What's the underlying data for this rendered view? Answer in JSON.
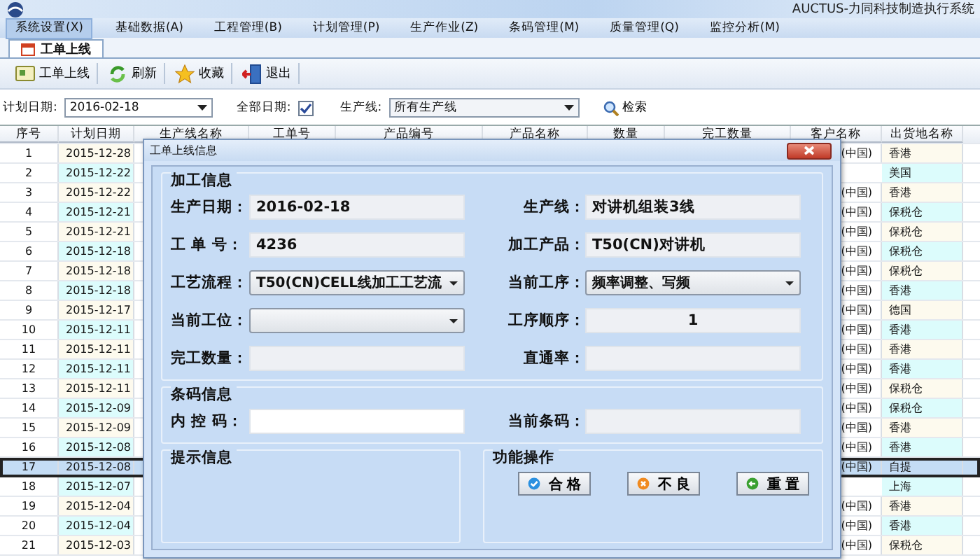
{
  "window": {
    "title": "AUCTUS-力同科技制造执行系统"
  },
  "menu": [
    {
      "label": "系统设置(X)",
      "selected": true
    },
    {
      "label": "基础数据(A)",
      "selected": false
    },
    {
      "label": "工程管理(B)",
      "selected": false
    },
    {
      "label": "计划管理(P)",
      "selected": false
    },
    {
      "label": "生产作业(Z)",
      "selected": false
    },
    {
      "label": "条码管理(M)",
      "selected": false
    },
    {
      "label": "质量管理(Q)",
      "selected": false
    },
    {
      "label": "监控分析(M)",
      "selected": false
    }
  ],
  "tabs": [
    {
      "label": "工单上线",
      "selected": true
    }
  ],
  "toolbar": [
    {
      "label": "工单上线",
      "kind": "online"
    },
    {
      "label": "刷新",
      "kind": "refresh"
    },
    {
      "label": "收藏",
      "kind": "star"
    },
    {
      "label": "退出",
      "kind": "exit"
    }
  ],
  "filter": {
    "plan_date_label": "计划日期:",
    "plan_date": "2016-02-18",
    "all_dates_label": "全部日期:",
    "all_dates_checked": true,
    "line_label": "生产线:",
    "line_value": "所有生产线",
    "search_label": "检索"
  },
  "table": {
    "columns": [
      "序号",
      "计划日期",
      "生产线名称",
      "工单号",
      "产品编号",
      "产品名称",
      "数量",
      "完工数量",
      "客户名称",
      "出货地名称"
    ],
    "rows": [
      {
        "no": "1",
        "date": "2015-12-28",
        "customer": "(中国)",
        "destination": "香港",
        "selected": false
      },
      {
        "no": "2",
        "date": "2015-12-22",
        "destination": "美国",
        "selected": false
      },
      {
        "no": "3",
        "date": "2015-12-22",
        "customer": "(中国)",
        "destination": "香港",
        "selected": false
      },
      {
        "no": "4",
        "date": "2015-12-21",
        "customer": "(中国)",
        "destination": "保税仓",
        "selected": false
      },
      {
        "no": "5",
        "date": "2015-12-21",
        "customer": "(中国)",
        "destination": "保税仓",
        "selected": false
      },
      {
        "no": "6",
        "date": "2015-12-18",
        "customer": "(中国)",
        "destination": "保税仓",
        "selected": false
      },
      {
        "no": "7",
        "date": "2015-12-18",
        "customer": "(中国)",
        "destination": "保税仓",
        "selected": false
      },
      {
        "no": "8",
        "date": "2015-12-18",
        "customer": "(中国)",
        "destination": "香港",
        "selected": false
      },
      {
        "no": "9",
        "date": "2015-12-17",
        "customer": "(中国)",
        "destination": "德国",
        "selected": false
      },
      {
        "no": "10",
        "date": "2015-12-11",
        "customer": "(中国)",
        "destination": "香港",
        "selected": false
      },
      {
        "no": "11",
        "date": "2015-12-11",
        "customer": "(中国)",
        "destination": "香港",
        "selected": false
      },
      {
        "no": "12",
        "date": "2015-12-11",
        "customer": "(中国)",
        "destination": "香港",
        "selected": false
      },
      {
        "no": "13",
        "date": "2015-12-11",
        "customer": "(中国)",
        "destination": "保税仓",
        "selected": false
      },
      {
        "no": "14",
        "date": "2015-12-09",
        "customer": "(中国)",
        "destination": "保税仓",
        "selected": false
      },
      {
        "no": "15",
        "date": "2015-12-09",
        "customer": "(中国)",
        "destination": "香港",
        "selected": false
      },
      {
        "no": "16",
        "date": "2015-12-08",
        "customer": "(中国)",
        "destination": "香港",
        "selected": false
      },
      {
        "no": "17",
        "date": "2015-12-08",
        "customer": "(中国)",
        "destination": "自提",
        "selected": true
      },
      {
        "no": "18",
        "date": "2015-12-07",
        "destination": "上海",
        "selected": false
      },
      {
        "no": "19",
        "date": "2015-12-04",
        "customer": "(中国)",
        "destination": "香港",
        "selected": false
      },
      {
        "no": "20",
        "date": "2015-12-04",
        "customer": "(中国)",
        "destination": "香港",
        "selected": false
      },
      {
        "no": "21",
        "date": "2015-12-03",
        "customer": "(中国)",
        "destination": "保税仓",
        "selected": false
      }
    ]
  },
  "dialog": {
    "title": "工单上线信息",
    "groups": [
      {
        "title": "加工信息",
        "fields": [
          {
            "label": "生产日期：",
            "value": "2016-02-18",
            "kind": "text"
          },
          {
            "label": "生产线：",
            "value": "对讲机组装3线",
            "kind": "text"
          },
          {
            "label": "工 单 号：",
            "value": "4236",
            "kind": "text"
          },
          {
            "label": "加工产品：",
            "value": "T50(CN)对讲机",
            "kind": "text"
          },
          {
            "label": "工艺流程：",
            "value": "T50(CN)CELL线加工工艺流",
            "kind": "dropdown"
          },
          {
            "label": "当前工序：",
            "value": "频率调整、写频",
            "kind": "dropdown"
          },
          {
            "label": "当前工位：",
            "kind": "dropdown"
          },
          {
            "label": "工序顺序：",
            "value": "1",
            "kind": "number"
          },
          {
            "label": "完工数量：",
            "kind": "text"
          },
          {
            "label": "直通率：",
            "kind": "text"
          }
        ]
      },
      {
        "title": "条码信息",
        "fields": [
          {
            "label": "内 控 码：",
            "kind": "input"
          },
          {
            "label": "当前条码：",
            "kind": "text"
          }
        ]
      }
    ],
    "hint_title": "提示信息",
    "actions_title": "功能操作",
    "buttons": [
      {
        "label": "合 格",
        "kind": "pass"
      },
      {
        "label": "不 良",
        "kind": "fail"
      },
      {
        "label": "重 置",
        "kind": "reset"
      }
    ]
  }
}
